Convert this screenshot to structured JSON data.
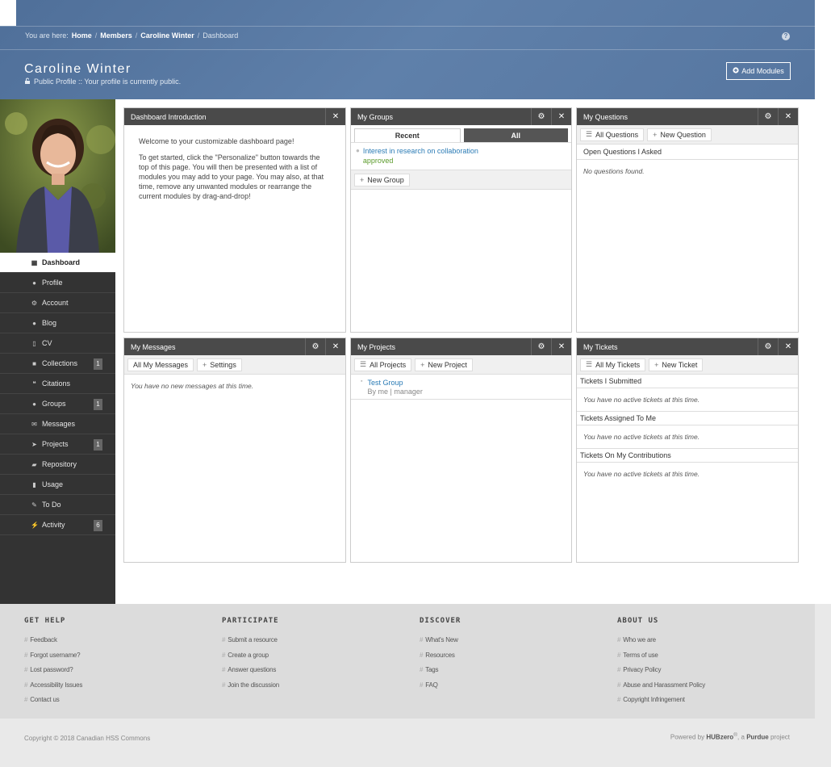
{
  "breadcrumb": {
    "prefix": "You are here:",
    "items": [
      "Home",
      "Members",
      "Caroline Winter"
    ],
    "current": "Dashboard"
  },
  "profile": {
    "name": "Caroline Winter",
    "status": "Public Profile :: Your profile is currently public.",
    "add_modules": "Add Modules"
  },
  "sidebar": {
    "items": [
      {
        "label": "Dashboard",
        "icon": "grid-icon"
      },
      {
        "label": "Profile",
        "icon": "user-icon"
      },
      {
        "label": "Account",
        "icon": "gears-icon"
      },
      {
        "label": "Blog",
        "icon": "comment-icon"
      },
      {
        "label": "CV",
        "icon": "file-icon"
      },
      {
        "label": "Collections",
        "icon": "briefcase-icon",
        "badge": "1"
      },
      {
        "label": "Citations",
        "icon": "quote-icon"
      },
      {
        "label": "Groups",
        "icon": "users-icon",
        "badge": "1"
      },
      {
        "label": "Messages",
        "icon": "envelope-icon"
      },
      {
        "label": "Projects",
        "icon": "send-icon",
        "badge": "1"
      },
      {
        "label": "Repository",
        "icon": "book-icon"
      },
      {
        "label": "Usage",
        "icon": "bar-chart-icon"
      },
      {
        "label": "To Do",
        "icon": "tasks-icon"
      },
      {
        "label": "Activity",
        "icon": "pulse-icon",
        "badge": "6"
      }
    ]
  },
  "intro": {
    "title": "Dashboard Introduction",
    "p1": "Welcome to your customizable dashboard page!",
    "p2": "To get started, click the \"Personalize\" button towards the top of this page. You will then be presented with a list of modules you may add to your page. You may also, at that time, remove any unwanted modules or rearrange the current modules by drag-and-drop!"
  },
  "groups": {
    "title": "My Groups",
    "tab_recent": "Recent",
    "tab_all": "All",
    "item_name": "Interest in research on collaboration",
    "item_status": "approved",
    "new_group": "New Group"
  },
  "questions": {
    "title": "My Questions",
    "all": "All Questions",
    "new": "New Question",
    "section": "Open Questions I Asked",
    "empty": "No questions found."
  },
  "messages": {
    "title": "My Messages",
    "all": "All My Messages",
    "settings": "Settings",
    "empty": "You have no new messages at this time."
  },
  "projects": {
    "title": "My Projects",
    "all": "All Projects",
    "new": "New Project",
    "item_name": "Test Group",
    "item_meta": "By me | manager"
  },
  "tickets": {
    "title": "My Tickets",
    "all": "All My Tickets",
    "new": "New Ticket",
    "sec1": "Tickets I Submitted",
    "sec2": "Tickets Assigned To Me",
    "sec3": "Tickets On My Contributions",
    "empty": "You have no active tickets at this time."
  },
  "footer": {
    "cols": [
      {
        "title": "GET HELP",
        "links": [
          "Feedback",
          "Forgot username?",
          "Lost password?",
          "Accessibility Issues",
          "Contact us"
        ]
      },
      {
        "title": "PARTICIPATE",
        "links": [
          "Submit a resource",
          "Create a group",
          "Answer questions",
          "Join the discussion"
        ]
      },
      {
        "title": "DISCOVER",
        "links": [
          "What's New",
          "Resources",
          "Tags",
          "FAQ"
        ]
      },
      {
        "title": "ABOUT US",
        "links": [
          "Who we are",
          "Terms of use",
          "Privacy Policy",
          "Abuse and Harassment Policy",
          "Copyright Infringement"
        ]
      }
    ],
    "copyright": "Copyright © 2018 Canadian HSS Commons",
    "powered_prefix": "Powered by",
    "powered_brand": "HUBzero",
    "powered_reg": "®",
    "powered_mid": ", a",
    "powered_org": "Purdue",
    "powered_suffix": "project"
  }
}
